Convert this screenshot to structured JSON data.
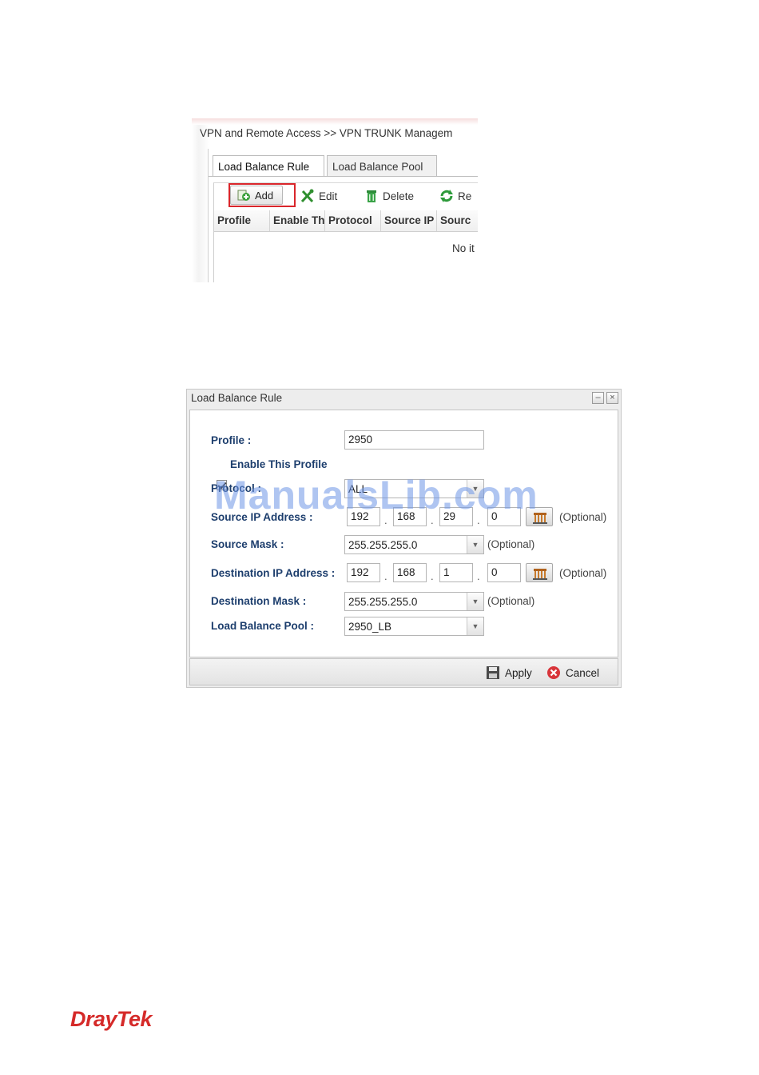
{
  "screenshot1": {
    "breadcrumb": "VPN and Remote Access >> VPN TRUNK Managem",
    "tabs": [
      {
        "label": "Load Balance Rule",
        "active": true
      },
      {
        "label": "Load Balance Pool",
        "active": false
      }
    ],
    "toolbar": {
      "add": "Add",
      "edit": "Edit",
      "delete": "Delete",
      "refresh": "Re"
    },
    "columns": [
      "Profile",
      "Enable Th",
      "Protocol",
      "Source IP",
      "Sourc"
    ],
    "empty_text": "No it",
    "highlight_color": "#d9262b"
  },
  "dialog": {
    "title": "Load Balance Rule",
    "minimize_glyph": "–",
    "close_glyph": "×",
    "profile": {
      "label": "Profile :",
      "value": "2950"
    },
    "enable": {
      "label": "Enable This Profile",
      "checked": true
    },
    "protocol": {
      "label": "Protocol :",
      "value": "ALL"
    },
    "source_ip": {
      "label": "Source IP Address :",
      "octets": [
        "192",
        "168",
        "29",
        "0"
      ],
      "optional": "(Optional)"
    },
    "source_mask": {
      "label": "Source Mask :",
      "value": "255.255.255.0",
      "optional": "(Optional)"
    },
    "dest_ip": {
      "label": "Destination IP Address :",
      "octets": [
        "192",
        "168",
        "1",
        "0"
      ],
      "optional": "(Optional)"
    },
    "dest_mask": {
      "label": "Destination Mask :",
      "value": "255.255.255.0",
      "optional": "(Optional)"
    },
    "pool": {
      "label": "Load Balance Pool :",
      "value": "2950_LB"
    },
    "buttons": {
      "apply": "Apply",
      "cancel": "Cancel"
    },
    "label_color": "#1d3e6d"
  },
  "watermark": "ManualsLib.com",
  "logo": "DrayTek",
  "brand_color": "#d52a29"
}
